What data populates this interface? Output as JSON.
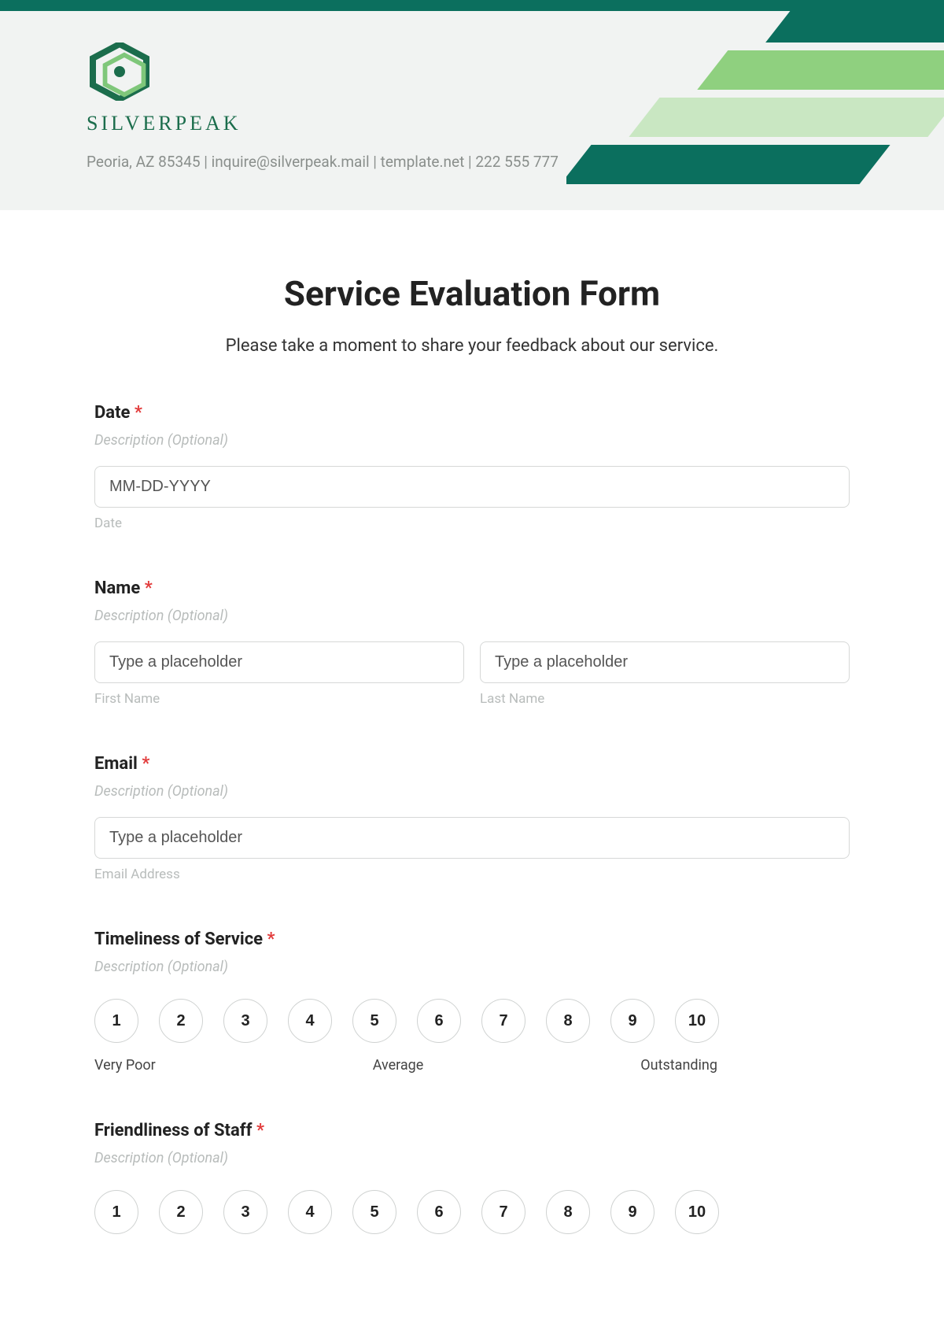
{
  "header": {
    "brand": "SILVERPEAK",
    "contact": "Peoria, AZ 85345 | inquire@silverpeak.mail | template.net | 222 555 777"
  },
  "form": {
    "title": "Service Evaluation Form",
    "subtitle": "Please take a moment to share your feedback about our service.",
    "required_marker": "*",
    "description_placeholder": "Description (Optional)",
    "fields": {
      "date": {
        "label": "Date",
        "placeholder": "MM-DD-YYYY",
        "sublabel": "Date"
      },
      "name": {
        "label": "Name",
        "first_placeholder": "Type a placeholder",
        "last_placeholder": "Type a placeholder",
        "first_sublabel": "First Name",
        "last_sublabel": "Last Name"
      },
      "email": {
        "label": "Email",
        "placeholder": "Type a placeholder",
        "sublabel": "Email Address"
      },
      "timeliness": {
        "label": "Timeliness of Service",
        "scale": [
          "1",
          "2",
          "3",
          "4",
          "5",
          "6",
          "7",
          "8",
          "9",
          "10"
        ],
        "anchors": {
          "low": "Very Poor",
          "mid": "Average",
          "high": "Outstanding"
        }
      },
      "friendliness": {
        "label": "Friendliness of Staff",
        "scale": [
          "1",
          "2",
          "3",
          "4",
          "5",
          "6",
          "7",
          "8",
          "9",
          "10"
        ]
      }
    }
  }
}
